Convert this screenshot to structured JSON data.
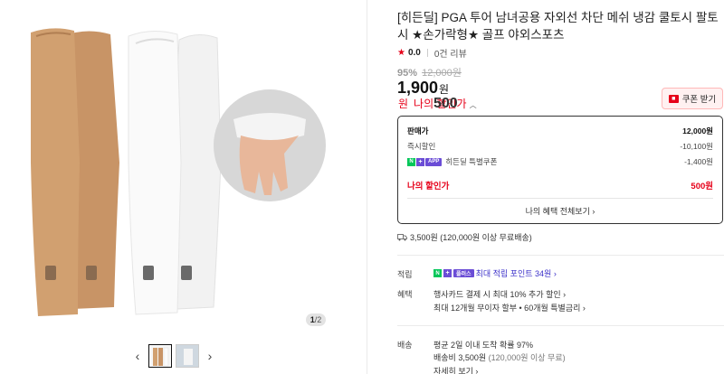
{
  "gallery": {
    "counter_current": "1",
    "counter_total": "/2",
    "prev_arrow": "‹",
    "next_arrow": "›",
    "thumbnails": [
      "thumb-1",
      "thumb-2"
    ]
  },
  "product": {
    "title": "[히든딜] PGA 투어 남녀공용 자외선 차단 메쉬 냉감 쿨토시 팔토시 ★손가락형★ 골프 야외스포츠",
    "rating_score": "0.0",
    "review_count": "0건 리뷰",
    "discount_pct": "95%",
    "original_price": "12,000원",
    "price": "1,900",
    "price_unit": "원",
    "my_discount_value": "500",
    "my_discount_unit": "원",
    "my_discount_label": "나의 할인가",
    "coupon_button": "쿠폰 받기"
  },
  "price_box": {
    "rows": [
      {
        "label": "판매가",
        "value": "12,000원"
      },
      {
        "label": "즉시할인",
        "value": "-10,100원"
      },
      {
        "label": "히든딜 특별쿠폰",
        "value": "-1,400원",
        "badges": [
          "N",
          "+",
          "APP"
        ]
      },
      {
        "label": "나의 할인가",
        "value": "500원"
      }
    ],
    "all_benefits": "나의 혜택 전체보기 ›"
  },
  "shipping_summary": "3,500원 (120,000원 이상 무료배송)",
  "info": {
    "points_label": "적립",
    "points_badge": "플러스",
    "points_text": "최대 적립 포인트 34원 ›",
    "benefit_label": "혜택",
    "benefit_line1": "행사카드 결제 시 최대 10% 추가 할인 ›",
    "benefit_line2": "최대 12개월 무이자 할부 • 60개월 특별금리 ›",
    "delivery_label": "배송",
    "delivery_line1": "평균 2일 이내 도착 확률 97%",
    "delivery_line2": "배송비 3,500원",
    "delivery_line2_note": "(120,000원 이상 무료)",
    "delivery_line3": "자세히 보기 ›"
  },
  "colors": {
    "accent_red": "#e60019",
    "naver_green": "#03c75a",
    "plus_purple": "#6b4dd6"
  }
}
